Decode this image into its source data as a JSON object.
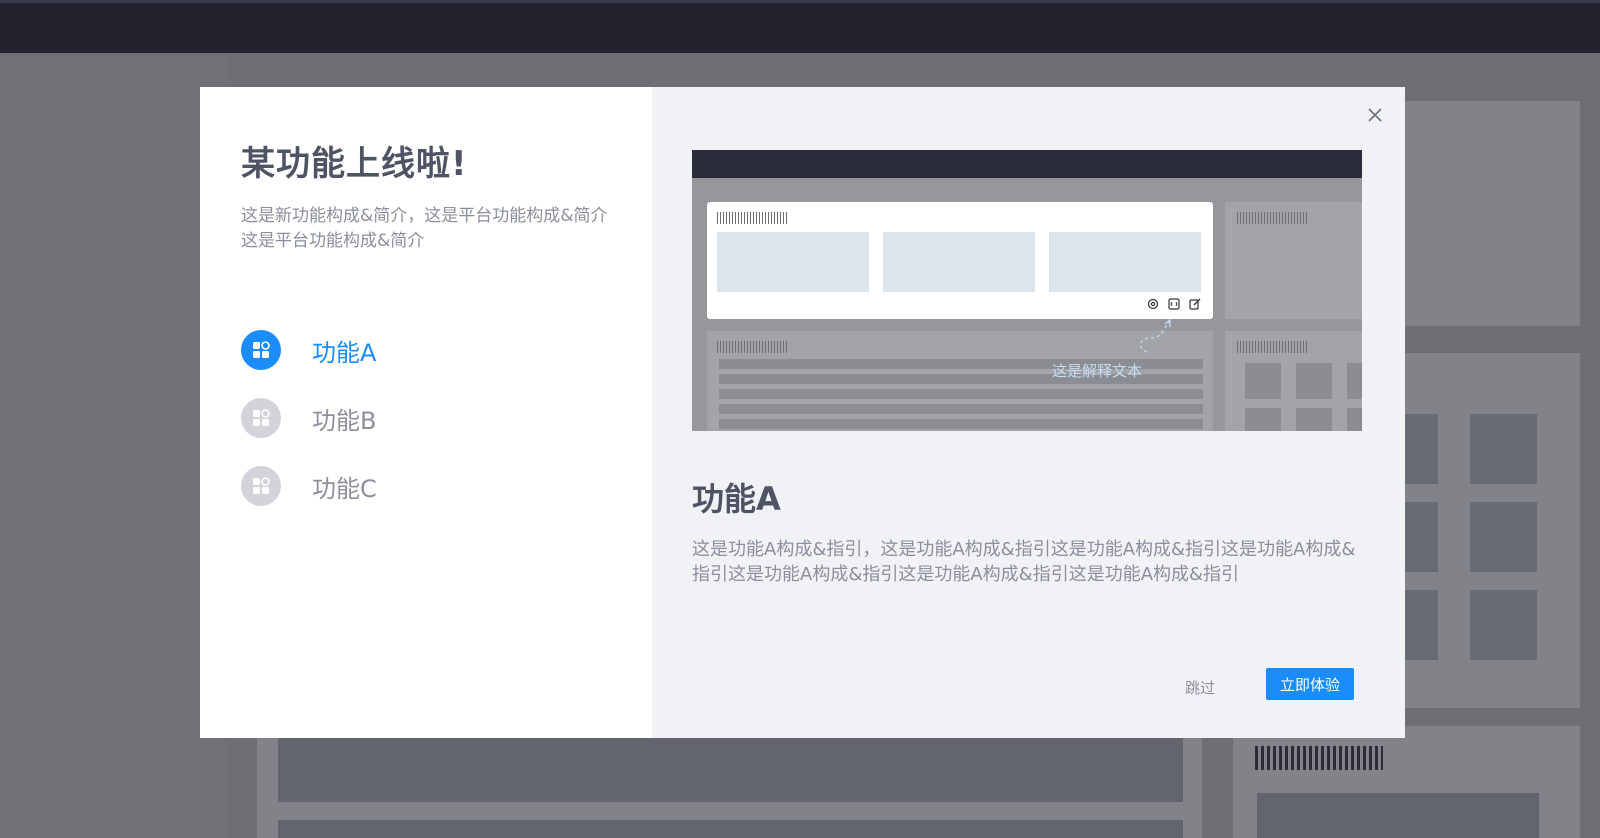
{
  "modal": {
    "title": "某功能上线啦!",
    "subtitle": "这是新功能构成&简介，这是平台功能构成&简介这是平台功能构成&简介",
    "features": [
      {
        "label": "功能A",
        "active": true
      },
      {
        "label": "功能B",
        "active": false
      },
      {
        "label": "功能C",
        "active": false
      }
    ],
    "preview": {
      "annotation": "这是解释文本"
    },
    "selected_feature": {
      "title": "功能A",
      "description": "这是功能A构成&指引，这是功能A构成&指引这是功能A构成&指引这是功能A构成&指引这是功能A构成&指引这是功能A构成&指引这是功能A构成&指引"
    },
    "skip_label": "跳过",
    "try_label": "立即体验"
  },
  "colors": {
    "accent": "#1a8dfb",
    "topbar": "#22232e"
  }
}
